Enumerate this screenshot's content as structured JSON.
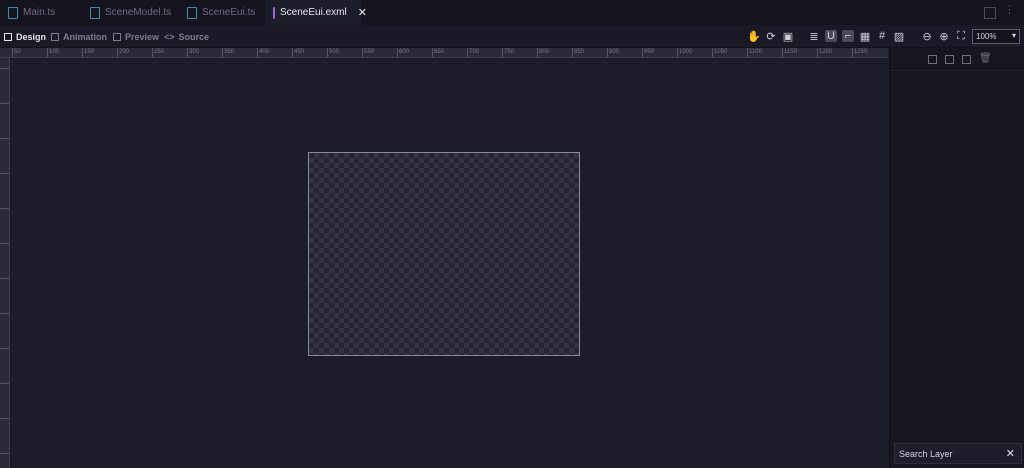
{
  "tabs": [
    {
      "label": "Main.ts",
      "icon": "typescript-file-icon",
      "active": false
    },
    {
      "label": "SceneModel.ts",
      "icon": "typescript-file-icon",
      "active": false
    },
    {
      "label": "SceneEui.ts",
      "icon": "typescript-file-icon",
      "active": false
    },
    {
      "label": "SceneEui.exml",
      "icon": "exml-file-icon",
      "active": true,
      "close": "✕"
    }
  ],
  "modes": [
    {
      "label": "Design",
      "icon": "design-icon",
      "active": true
    },
    {
      "label": "Animation",
      "icon": "animation-icon",
      "active": false
    },
    {
      "label": "Preview",
      "icon": "preview-icon",
      "active": false
    },
    {
      "label": "Source",
      "icon": "source-icon",
      "active": false
    }
  ],
  "toolbar": {
    "tools": [
      "hand-tool-icon",
      "refresh-icon",
      "fit-screen-icon",
      "align-icon",
      "magnet-icon",
      "ruler-guide-icon",
      "grid-icon",
      "grid-snap-icon",
      "image-icon"
    ],
    "zoom_out_icon": "zoom-out-icon",
    "zoom_in_icon": "zoom-in-icon",
    "fit_icon": "fit-icon",
    "zoom_value": "100%",
    "accent": "#9a63d6"
  },
  "ruler": {
    "top_labels": [
      "50",
      "100",
      "150",
      "200",
      "250",
      "300",
      "350",
      "400",
      "450",
      "500",
      "550",
      "600",
      "650",
      "700",
      "750",
      "800",
      "850",
      "900",
      "950",
      "1000",
      "1050",
      "1100",
      "1150",
      "1200",
      "1250"
    ]
  },
  "layers_panel": {
    "icons": [
      "group-layer-icon",
      "ungroup-layer-icon",
      "copy-layer-icon",
      "delete-layer-icon"
    ],
    "search_placeholder": "Search Layer",
    "clear": "✕"
  }
}
